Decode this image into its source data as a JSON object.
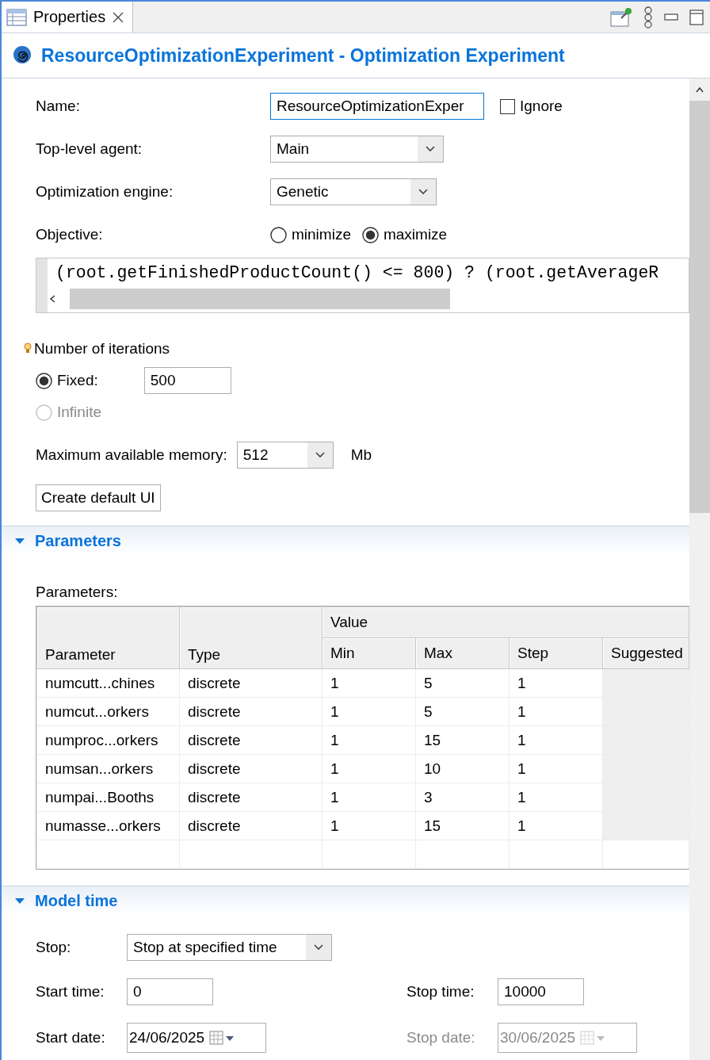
{
  "tab": {
    "label": "Properties",
    "selected": true
  },
  "title": "ResourceOptimizationExperiment - Optimization Experiment",
  "form": {
    "name": {
      "label": "Name:",
      "value": "ResourceOptimizationExper",
      "ignore": {
        "label": "Ignore",
        "checked": false
      }
    },
    "top_level_agent": {
      "label": "Top-level agent:",
      "value": "Main"
    },
    "optimization_engine": {
      "label": "Optimization engine:",
      "value": "Genetic"
    },
    "objective": {
      "label": "Objective:",
      "options": [
        {
          "label": "minimize",
          "selected": false
        },
        {
          "label": "maximize",
          "selected": true
        }
      ],
      "expression": "(root.getFinishedProductCount() <= 800) ? (root.getAverageR"
    },
    "iterations": {
      "label": "Number of iterations",
      "options": [
        {
          "label": "Fixed:",
          "selected": true,
          "disabled": false
        },
        {
          "label": "Infinite",
          "selected": false,
          "disabled": true
        }
      ],
      "fixed_value": "500"
    },
    "memory": {
      "label": "Maximum available memory:",
      "value": "512",
      "unit": "Mb"
    },
    "create_button": "Create default UI"
  },
  "parameters_section": {
    "title": "Parameters",
    "expanded": true,
    "table_label": "Parameters:",
    "table": {
      "group_header": "Value",
      "columns": [
        "Parameter",
        "Type",
        "Min",
        "Max",
        "Step",
        "Suggested"
      ],
      "rows": [
        [
          "numcutt...chines",
          "discrete",
          "1",
          "5",
          "1"
        ],
        [
          "numcut...orkers",
          "discrete",
          "1",
          "5",
          "1"
        ],
        [
          "numproc...orkers",
          "discrete",
          "1",
          "15",
          "1"
        ],
        [
          "numsan...orkers",
          "discrete",
          "1",
          "10",
          "1"
        ],
        [
          "numpai...Booths",
          "discrete",
          "1",
          "3",
          "1"
        ],
        [
          "numasse...orkers",
          "discrete",
          "1",
          "15",
          "1"
        ]
      ]
    }
  },
  "model_time_section": {
    "title": "Model time",
    "expanded": true,
    "stop": {
      "label": "Stop:",
      "value": "Stop at specified time"
    },
    "start_time": {
      "label": "Start time:",
      "value": "0"
    },
    "stop_time": {
      "label": "Stop time:",
      "value": "10000"
    },
    "start_date": {
      "label": "Start date:",
      "value": "24/06/2025",
      "disabled": false
    },
    "stop_date": {
      "label": "Stop date:",
      "value": "30/06/2025",
      "disabled": true
    }
  }
}
